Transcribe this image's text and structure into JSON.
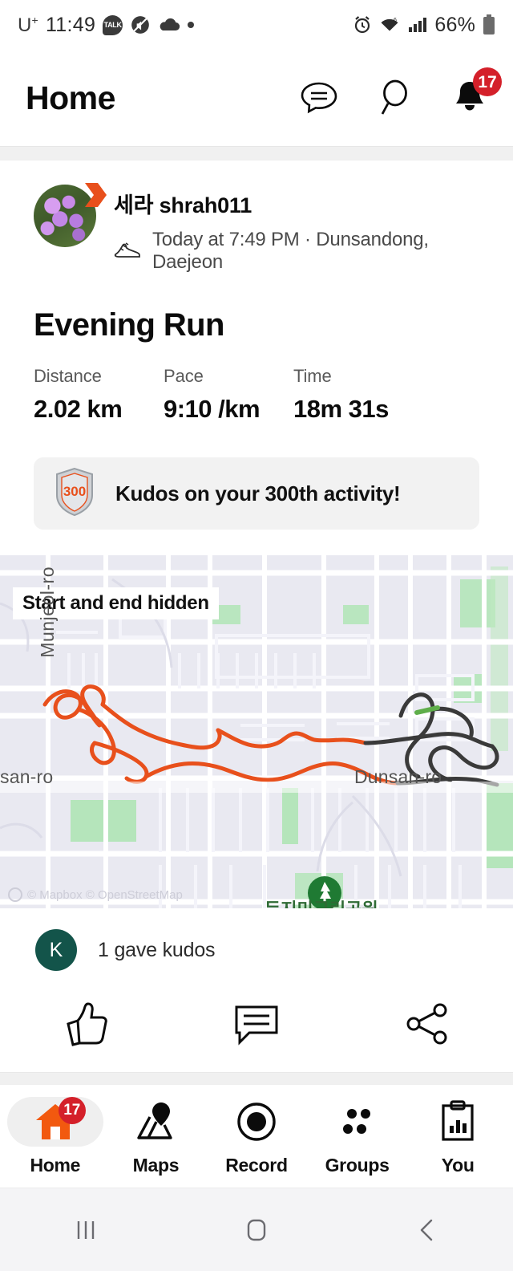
{
  "status_bar": {
    "carrier": "U",
    "carrier_sup": "+",
    "time": "11:49",
    "kakao_label": "TALK",
    "battery_percent": "66%",
    "icons": [
      "kakaotalk-icon",
      "mute-icon",
      "cloud-icon",
      "dot-icon",
      "alarm-icon",
      "wifi-icon",
      "signal-icon",
      "battery-icon"
    ]
  },
  "header": {
    "title": "Home",
    "chat_icon": "chat-bubble-icon",
    "search_icon": "search-icon",
    "notifications_icon": "bell-icon",
    "notifications_badge": "17"
  },
  "activity": {
    "athlete_name": "세라 shrah011",
    "activity_type_icon": "running-shoe-icon",
    "subtitle": "Today at 7:49 PM · Dunsandong, Daejeon",
    "title": "Evening Run",
    "stats": [
      {
        "label": "Distance",
        "value": "2.02 km"
      },
      {
        "label": "Pace",
        "value": "9:10 /km"
      },
      {
        "label": "Time",
        "value": "18m 31s"
      }
    ],
    "achievement": {
      "badge_number": "300",
      "text": "Kudos on your 300th activity!"
    },
    "map": {
      "privacy_label": "Start and end hidden",
      "street_vertical": "Munjeol-ro",
      "street_left": "san-ro",
      "street_right": "Dunsan-ro",
      "poi_label": "둔지미근린공원",
      "attribution": "© Mapbox © OpenStreetMap",
      "route_color_primary": "#e8501c",
      "route_color_secondary": "#3a3a3a"
    },
    "kudos": {
      "avatar_initial": "K",
      "text": "1 gave kudos"
    },
    "actions": [
      {
        "name": "kudos-button",
        "icon": "thumbs-up-icon"
      },
      {
        "name": "comment-button",
        "icon": "comment-icon"
      },
      {
        "name": "share-button",
        "icon": "share-icon"
      }
    ]
  },
  "bottom_nav": {
    "items": [
      {
        "label": "Home",
        "icon": "home-icon",
        "active": true,
        "badge": "17"
      },
      {
        "label": "Maps",
        "icon": "map-pin-icon",
        "active": false,
        "badge": ""
      },
      {
        "label": "Record",
        "icon": "record-icon",
        "active": false,
        "badge": ""
      },
      {
        "label": "Groups",
        "icon": "groups-icon",
        "active": false,
        "badge": ""
      },
      {
        "label": "You",
        "icon": "clipboard-chart-icon",
        "active": false,
        "badge": ""
      }
    ]
  },
  "android_nav": {
    "recents": "recents-icon",
    "home": "home-square-icon",
    "back": "back-icon"
  },
  "colors": {
    "brand_orange": "#e8501c",
    "badge_red": "#d4202a",
    "kudos_green": "#13544a",
    "map_bg": "#e9e9f1"
  }
}
